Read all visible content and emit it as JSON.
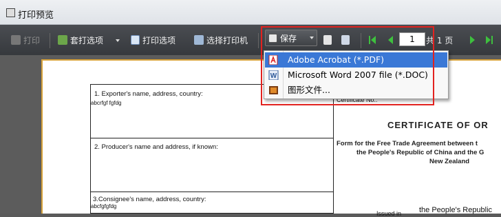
{
  "window": {
    "title": "打印预览"
  },
  "toolbar": {
    "print_label": "打印",
    "template_print_label": "套打选项",
    "print_options_label": "打印选项",
    "select_printer_label": "选择打印机",
    "save_label": "保存",
    "page_number": "1",
    "total_pages_label": "共 1 页"
  },
  "save_menu": {
    "items": [
      {
        "label": "Adobe Acrobat (*.PDF)",
        "icon": "pdf-icon"
      },
      {
        "label": "Microsoft Word 2007 file (*.DOC)",
        "icon": "word-icon"
      },
      {
        "label": "图形文件..."
      }
    ]
  },
  "document": {
    "exporter_label": "1. Exporter's name, address, country:",
    "exporter_value": "abcrfgf fgfdg",
    "producer_label": "2. Producer's name and address, if known:",
    "consignee_label": "3.Consignee's name, address, country:",
    "consignee_value": "abcfgfgfdg",
    "certificate_no_label": "Certificate No.:",
    "certificate_title": "CERTIFICATE OF OR",
    "agreement_line1": "Form for the Free Trade Agreement between t",
    "agreement_line2": "the People's Republic of China and the G",
    "agreement_line3": "New Zealand",
    "issued_in_label": "Issued in",
    "issued_in_value": "the People's Republic"
  },
  "colors": {
    "highlight": "#3a78d6",
    "annotation_box": "#e2221f",
    "toolbar_bg": "#3f4246"
  }
}
